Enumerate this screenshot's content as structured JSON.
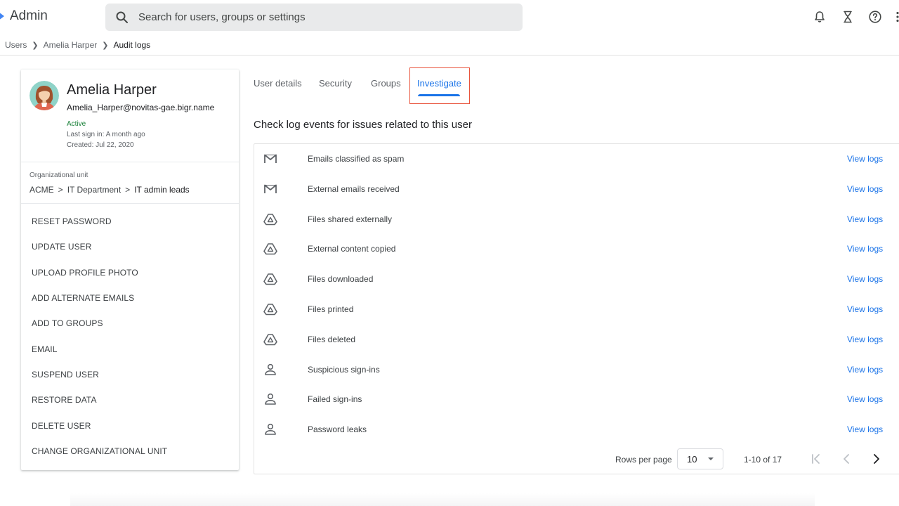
{
  "app": {
    "name": "Admin",
    "accent": "#1a73e8",
    "logo_color": "#4285f4"
  },
  "search": {
    "placeholder": "Search for users, groups or settings"
  },
  "topbar_icons": [
    "bell-icon",
    "hourglass-icon",
    "help-icon",
    "more-vert-icon"
  ],
  "breadcrumb": {
    "items": [
      "Users",
      "Amelia Harper"
    ],
    "current": "Audit logs"
  },
  "user": {
    "name": "Amelia Harper",
    "email": "Amelia_Harper@novitas-gae.bigr.name",
    "status": "Active",
    "status_color": "#188038",
    "last_sign_in": "Last sign in: A month ago",
    "created": "Created: Jul 22, 2020"
  },
  "org_unit": {
    "label": "Organizational unit",
    "path": [
      "ACME",
      "IT Department"
    ],
    "current": "IT admin leads"
  },
  "actions": [
    "RESET PASSWORD",
    "UPDATE USER",
    "UPLOAD PROFILE PHOTO",
    "ADD ALTERNATE EMAILS",
    "ADD TO GROUPS",
    "EMAIL",
    "SUSPEND USER",
    "RESTORE DATA",
    "DELETE USER",
    "CHANGE ORGANIZATIONAL UNIT"
  ],
  "tabs": [
    "User details",
    "Security",
    "Groups",
    "Investigate"
  ],
  "active_tab": "Investigate",
  "section_title": "Check log events for issues related to this user",
  "log_rows": [
    {
      "icon": "gmail-icon",
      "label": "Emails classified as spam",
      "link": "View logs"
    },
    {
      "icon": "gmail-icon",
      "label": "External emails received",
      "link": "View logs"
    },
    {
      "icon": "drive-icon",
      "label": "Files shared externally",
      "link": "View logs"
    },
    {
      "icon": "drive-icon",
      "label": "External content copied",
      "link": "View logs"
    },
    {
      "icon": "drive-icon",
      "label": "Files downloaded",
      "link": "View logs"
    },
    {
      "icon": "drive-icon",
      "label": "Files printed",
      "link": "View logs"
    },
    {
      "icon": "drive-icon",
      "label": "Files deleted",
      "link": "View logs"
    },
    {
      "icon": "person-icon",
      "label": "Suspicious sign-ins",
      "link": "View logs"
    },
    {
      "icon": "person-icon",
      "label": "Failed sign-ins",
      "link": "View logs"
    },
    {
      "icon": "person-icon",
      "label": "Password leaks",
      "link": "View logs"
    }
  ],
  "pagination": {
    "rows_per_page_label": "Rows per page",
    "rows_per_page": "10",
    "range": "1-10 of 17"
  }
}
